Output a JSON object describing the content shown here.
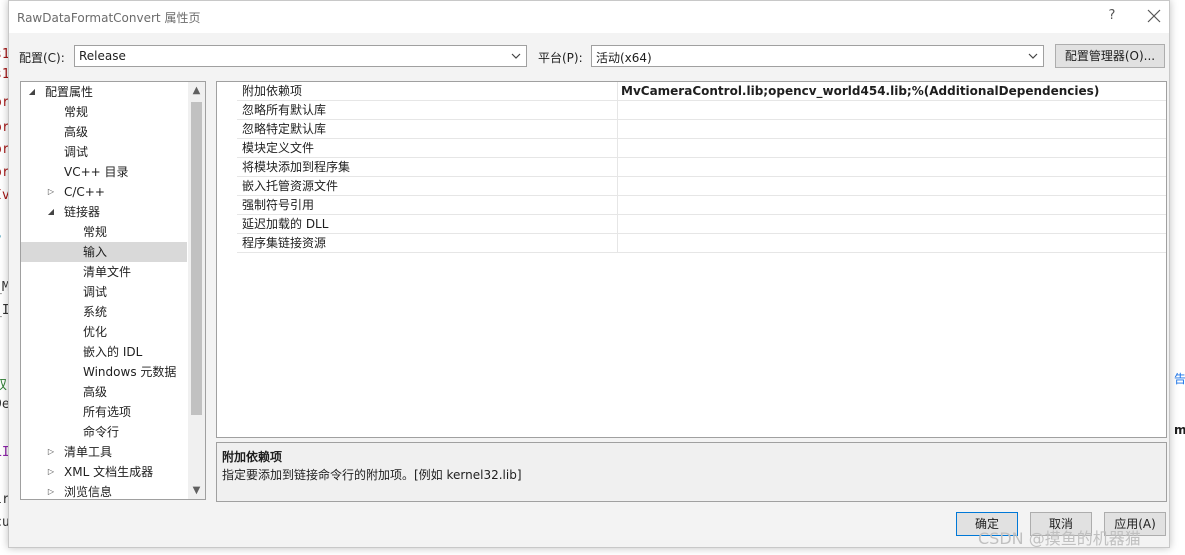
{
  "background": {
    "left_fragments": [
      "s1",
      "s1",
      "or",
      "or",
      "or",
      "or",
      "Iv",
      "?",
      "_M",
      "_I",
      "奴",
      "De",
      "LI",
      "ir",
      "cu"
    ],
    "right_fragments": [
      "告",
      "m"
    ]
  },
  "dialog": {
    "title": "RawDataFormatConvert 属性页",
    "help_label": "?",
    "close_icon": "close-icon"
  },
  "toolbar": {
    "config_label": "配置(C):",
    "config_value": "Release",
    "platform_label": "平台(P):",
    "platform_value": "活动(x64)",
    "config_manager_label": "配置管理器(O)..."
  },
  "tree": {
    "items": [
      {
        "label": "配置属性",
        "toggle": "◢"
      },
      {
        "label": "常规",
        "toggle": ""
      },
      {
        "label": "高级",
        "toggle": ""
      },
      {
        "label": "调试",
        "toggle": ""
      },
      {
        "label": "VC++ 目录",
        "toggle": ""
      },
      {
        "label": "C/C++",
        "toggle": "▷"
      },
      {
        "label": "链接器",
        "toggle": "◢"
      },
      {
        "label": "常规",
        "toggle": ""
      },
      {
        "label": "输入",
        "toggle": ""
      },
      {
        "label": "清单文件",
        "toggle": ""
      },
      {
        "label": "调试",
        "toggle": ""
      },
      {
        "label": "系统",
        "toggle": ""
      },
      {
        "label": "优化",
        "toggle": ""
      },
      {
        "label": "嵌入的 IDL",
        "toggle": ""
      },
      {
        "label": "Windows 元数据",
        "toggle": ""
      },
      {
        "label": "高级",
        "toggle": ""
      },
      {
        "label": "所有选项",
        "toggle": ""
      },
      {
        "label": "命令行",
        "toggle": ""
      },
      {
        "label": "清单工具",
        "toggle": "▷"
      },
      {
        "label": "XML 文档生成器",
        "toggle": "▷"
      },
      {
        "label": "浏览信息",
        "toggle": "▷"
      }
    ],
    "selected_index": 8
  },
  "grid": {
    "rows": [
      {
        "name": "附加依赖项",
        "value": "MvCameraControl.lib;opencv_world454.lib;%(AdditionalDependencies)"
      },
      {
        "name": "忽略所有默认库",
        "value": ""
      },
      {
        "name": "忽略特定默认库",
        "value": ""
      },
      {
        "name": "模块定义文件",
        "value": ""
      },
      {
        "name": "将模块添加到程序集",
        "value": ""
      },
      {
        "name": "嵌入托管资源文件",
        "value": ""
      },
      {
        "name": "强制符号引用",
        "value": ""
      },
      {
        "name": "延迟加载的 DLL",
        "value": ""
      },
      {
        "name": "程序集链接资源",
        "value": ""
      }
    ]
  },
  "description": {
    "title": "附加依赖项",
    "text": "指定要添加到链接命令行的附加项。[例如 kernel32.lib]"
  },
  "buttons": {
    "ok": "确定",
    "cancel": "取消",
    "apply": "应用(A)"
  },
  "watermark": "CSDN @摸鱼的机器猫"
}
